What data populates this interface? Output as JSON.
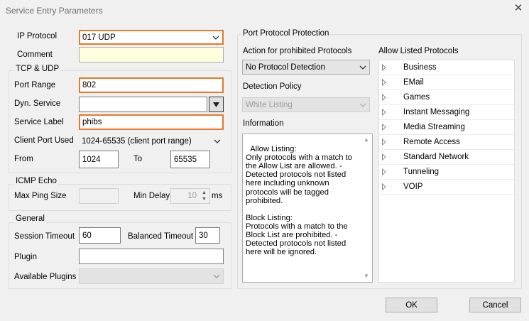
{
  "window": {
    "title": "Service Entry Parameters"
  },
  "left": {
    "ip_protocol": {
      "label": "IP Protocol",
      "value": "017 UDP"
    },
    "comment": {
      "label": "Comment",
      "value": ""
    },
    "tcp_udp": {
      "title": "TCP & UDP",
      "port_range": {
        "label": "Port Range",
        "value": "802"
      },
      "dyn_service": {
        "label": "Dyn. Service",
        "value": ""
      },
      "service_label": {
        "label": "Service Label",
        "value": "phibs"
      },
      "client_port_used": {
        "label": "Client Port Used",
        "value": "1024-65535 (client port range)"
      },
      "from": {
        "label": "From",
        "value": "1024"
      },
      "to": {
        "label": "To",
        "value": "65535"
      }
    },
    "icmp": {
      "title": "ICMP Echo",
      "max_ping_size": {
        "label": "Max Ping Size",
        "value": ""
      },
      "min_delay": {
        "label": "Min Delay",
        "value": "10",
        "unit": "ms"
      }
    },
    "general": {
      "title": "General",
      "session_timeout": {
        "label": "Session Timeout",
        "value": "60"
      },
      "balanced_timeout": {
        "label": "Balanced Timeout",
        "value": "30"
      },
      "plugin": {
        "label": "Plugin",
        "value": ""
      },
      "available_plugins": {
        "label": "Available Plugins",
        "value": ""
      }
    }
  },
  "right": {
    "title": "Port Protocol Protection",
    "action": {
      "label": "Action for prohibited Protocols",
      "value": "No Protocol Detection"
    },
    "detection_policy": {
      "label": "Detection Policy",
      "value": "White Listing"
    },
    "information": {
      "label": "Information",
      "text": "Allow Listing:\nOnly protocols with a match to the Allow List are allowed. - Detected protocols not listed here including unknown protocols will be tagged prohibited.\n\nBlock Listing:\nProtocols with a match to the Block List are prohibited. - Detected protocols not listed here will be ignored."
    },
    "allow_listed": {
      "label": "Allow Listed Protocols",
      "items": [
        "Business",
        "EMail",
        "Games",
        "Instant Messaging",
        "Media Streaming",
        "Remote Access",
        "Standard Network",
        "Tunneling",
        "VOIP"
      ]
    }
  },
  "buttons": {
    "ok": "OK",
    "cancel": "Cancel"
  },
  "icons": {
    "close": "close-icon",
    "dropdown": "chevron-down-icon",
    "expand": "expand-arrow-icon",
    "spin": "spin-updown-icon"
  },
  "colors": {
    "accent_border": "#e8782c",
    "comment_bg": "#ffffdd",
    "window_bg": "#f0f0f0"
  }
}
